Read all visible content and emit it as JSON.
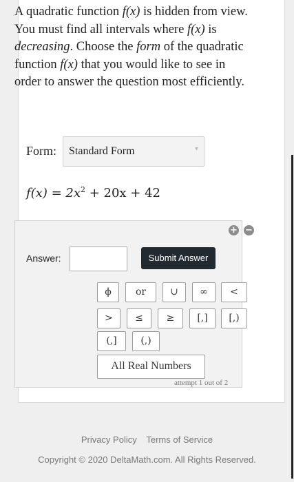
{
  "question": {
    "p1": "A quadratic function ",
    "fx1": "f(x)",
    "p2": " is hidden from view. You must find all intervals where ",
    "fx2": "f(x)",
    "p3": " is ",
    "emph1": "decreasing",
    "p4": ". Choose the ",
    "emph2": "form",
    "p5": " of the quadratic function ",
    "fx3": "f(x)",
    "p6": " that you would like to see in order to answer the question most efficiently."
  },
  "form": {
    "label": "Form:",
    "selected": "Standard Form"
  },
  "function": {
    "lhs": "f(x) = 2x",
    "exp": "2",
    "rhs": " + 20x + 42"
  },
  "answer": {
    "label": "Answer:",
    "value": "",
    "submit_label": "Submit Answer"
  },
  "keypad": [
    "ϕ",
    "or",
    "∪",
    "∞",
    "<",
    ">",
    "≤",
    "≥",
    "[,]",
    "[,)",
    "(,]",
    "(,)",
    "All Real Numbers"
  ],
  "attempt_text": "attempt 1 out of 2",
  "footer": {
    "privacy": "Privacy Policy",
    "terms": "Terms of Service",
    "copyright": "Copyright © 2020 DeltaMath.com. All Rights Reserved."
  },
  "icons": {
    "add": "plus-circle-icon",
    "remove": "minus-circle-icon",
    "dropdown": "chevron-down-icon"
  }
}
